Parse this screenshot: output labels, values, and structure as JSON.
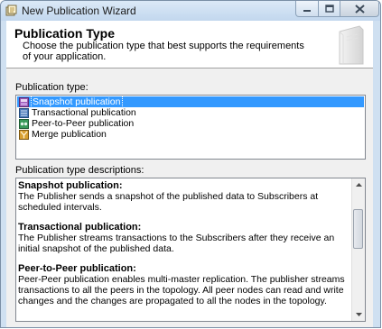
{
  "window": {
    "title": "New Publication Wizard"
  },
  "header": {
    "title": "Publication Type",
    "description": "Choose the publication type that best supports the requirements of your application."
  },
  "publication_types": {
    "label": "Publication type:",
    "selected": "Snapshot publication",
    "items": [
      {
        "label": "Snapshot publication",
        "icon": "snapshot-publication-icon"
      },
      {
        "label": "Transactional publication",
        "icon": "transactional-publication-icon"
      },
      {
        "label": "Peer-to-Peer publication",
        "icon": "peer-to-peer-publication-icon"
      },
      {
        "label": "Merge publication",
        "icon": "merge-publication-icon"
      }
    ]
  },
  "descriptions": {
    "label": "Publication type descriptions:",
    "items": [
      {
        "title": "Snapshot publication:",
        "text": "The Publisher sends a snapshot of the published data to Subscribers at scheduled intervals."
      },
      {
        "title": "Transactional publication:",
        "text": "The Publisher streams transactions to the Subscribers after they receive an initial snapshot of the published data."
      },
      {
        "title": "Peer-to-Peer publication:",
        "text": "Peer-Peer publication enables multi-master replication. The publisher streams transactions to all the peers in the topology. All peer nodes can read and write changes and the changes are propagated to all the nodes in the topology."
      }
    ]
  },
  "colors": {
    "selection": "#3399ff",
    "titlebar": "#c2d7ee",
    "header_bg": "#ffffff"
  }
}
